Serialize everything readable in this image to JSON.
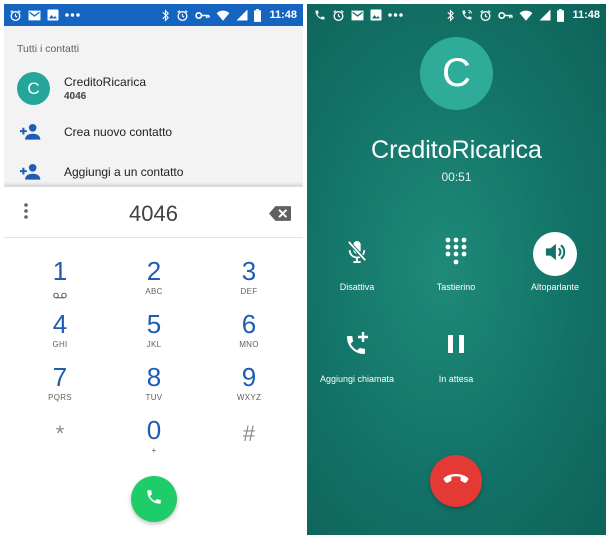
{
  "status_bar": {
    "time": "11:48"
  },
  "dialer": {
    "section_title": "Tutti i contatti",
    "contact": {
      "initial": "C",
      "name": "CreditoRicarica",
      "number": "4046"
    },
    "actions": [
      {
        "label": "Crea nuovo contatto"
      },
      {
        "label": "Aggiungi a un contatto"
      }
    ],
    "dialed_number": "4046",
    "keys": [
      {
        "digit": "1",
        "letters": ""
      },
      {
        "digit": "2",
        "letters": "ABC"
      },
      {
        "digit": "3",
        "letters": "DEF"
      },
      {
        "digit": "4",
        "letters": "GHI"
      },
      {
        "digit": "5",
        "letters": "JKL"
      },
      {
        "digit": "6",
        "letters": "MNO"
      },
      {
        "digit": "7",
        "letters": "PQRS"
      },
      {
        "digit": "8",
        "letters": "TUV"
      },
      {
        "digit": "9",
        "letters": "WXYZ"
      },
      {
        "digit": "*",
        "letters": ""
      },
      {
        "digit": "0",
        "letters": "+"
      },
      {
        "digit": "#",
        "letters": ""
      }
    ],
    "accent_color": "#1e5db3",
    "call_button_color": "#1fcc6a"
  },
  "in_call": {
    "initial": "C",
    "caller_name": "CreditoRicarica",
    "duration": "00:51",
    "controls": {
      "mute": "Disattiva",
      "keypad": "Tastierino",
      "speaker": "Altoparlante",
      "add_call": "Aggiungi chiamata",
      "hold": "In attesa"
    },
    "background_color": "#137368",
    "end_call_color": "#e53935"
  }
}
